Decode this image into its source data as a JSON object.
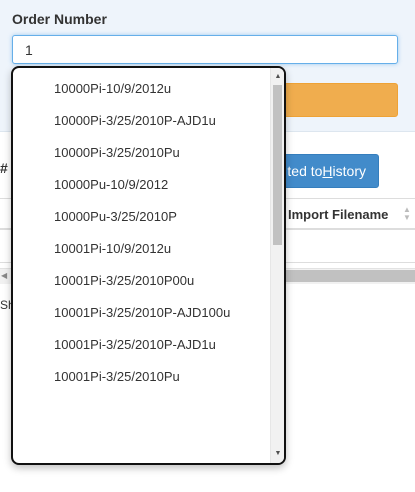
{
  "form": {
    "label": "Order Number",
    "input_value": "1"
  },
  "background": {
    "hash_fragment": "#",
    "history_button": {
      "prefix": "ted to ",
      "access": "H",
      "rest": "istory"
    },
    "table_header": "Import Filename",
    "footer_fragment": "Sh"
  },
  "autocomplete": {
    "items": [
      "10000Pi-10/9/2012u",
      "10000Pi-3/25/2010P-AJD1u",
      "10000Pi-3/25/2010Pu",
      "10000Pu-10/9/2012",
      "10000Pu-3/25/2010P",
      "10001Pi-10/9/2012u",
      "10001Pi-3/25/2010P00u",
      "10001Pi-3/25/2010P-AJD100u",
      "10001Pi-3/25/2010P-AJD1u",
      "10001Pi-3/25/2010Pu"
    ]
  },
  "colors": {
    "primary": "#428bca",
    "warning": "#f0ad4e",
    "panel": "#eef4fb"
  },
  "icons": {
    "sort": "sort-arrows-icon",
    "scroll_up": "triangle-up-icon",
    "scroll_down": "triangle-down-icon",
    "scroll_left": "triangle-left-icon"
  }
}
